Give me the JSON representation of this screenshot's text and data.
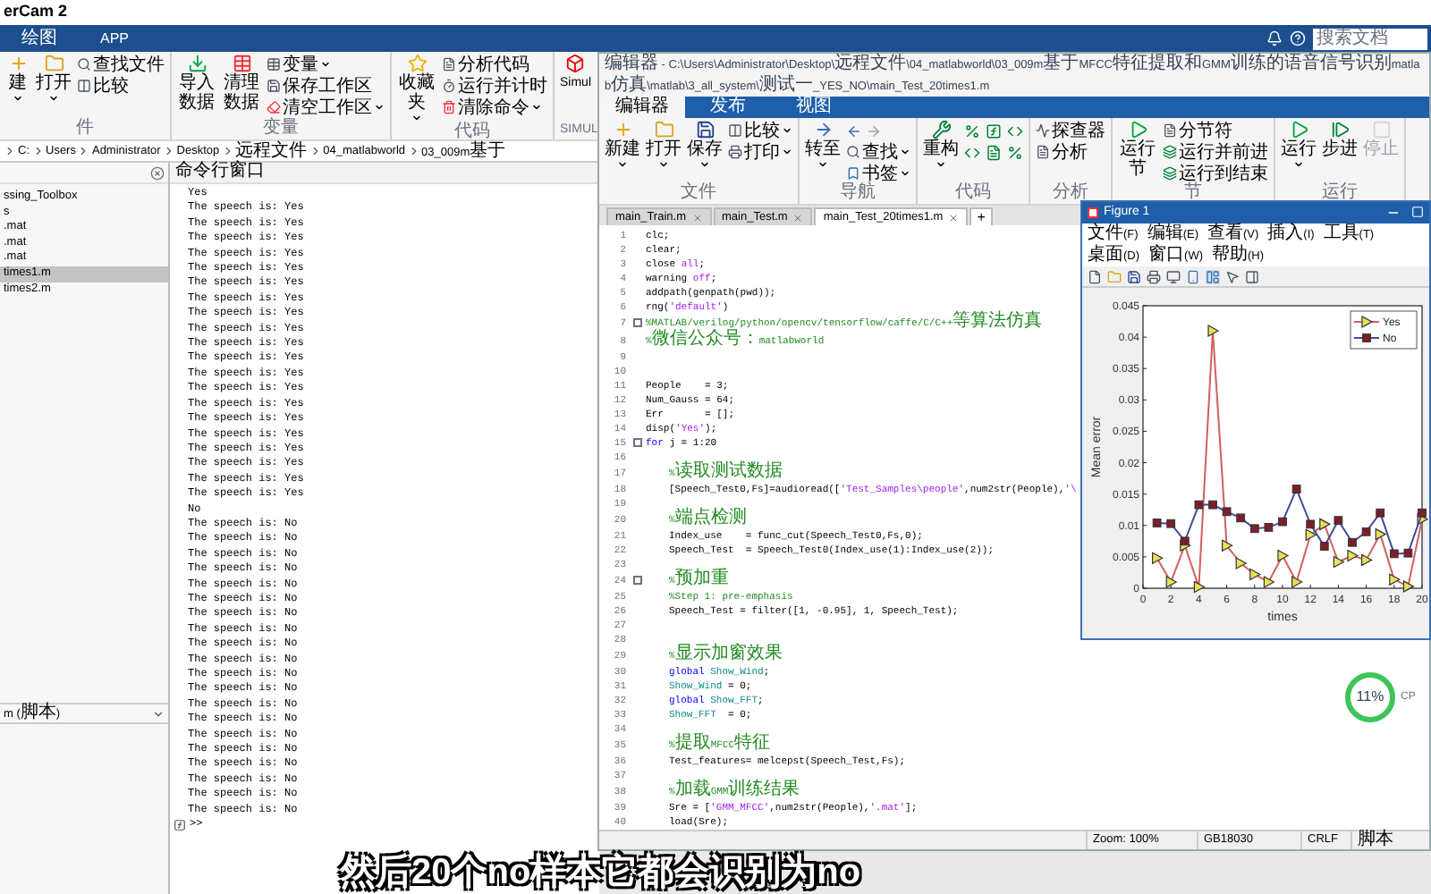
{
  "app_title": "erCam 2",
  "main_tabs": [
    {
      "label": "绘图",
      "selected": false
    },
    {
      "label": "APP",
      "selected": false
    }
  ],
  "search": {
    "placeholder": "搜索文档"
  },
  "main_toolstrip": [
    {
      "label": "件",
      "items": [
        {
          "label": "建",
          "kind": "large",
          "menu": true,
          "disabled": false
        },
        {
          "label": "打开",
          "kind": "large",
          "menu": true,
          "disabled": false
        },
        {
          "label": "查找文件",
          "kind": "small",
          "menu": false,
          "disabled": false
        },
        {
          "label": "比较",
          "kind": "small",
          "menu": false,
          "disabled": false
        }
      ]
    },
    {
      "label": "变量",
      "items": [
        {
          "label": "导入数据",
          "kind": "large",
          "menu": false,
          "disabled": false
        },
        {
          "label": "清理数据",
          "kind": "large",
          "menu": false,
          "disabled": false
        },
        {
          "label": "变量",
          "kind": "small",
          "menu": true,
          "disabled": false
        },
        {
          "label": "保存工作区",
          "kind": "small",
          "menu": false,
          "disabled": false
        },
        {
          "label": "清空工作区",
          "kind": "small",
          "menu": true,
          "disabled": false
        }
      ]
    },
    {
      "label": "代码",
      "items": [
        {
          "label": "收藏夹",
          "kind": "large",
          "menu": true,
          "disabled": false
        },
        {
          "label": "分析代码",
          "kind": "small",
          "menu": false,
          "disabled": false
        },
        {
          "label": "运行并计时",
          "kind": "small",
          "menu": false,
          "disabled": false
        },
        {
          "label": "清除命令",
          "kind": "small",
          "menu": true,
          "disabled": false
        }
      ]
    },
    {
      "label": "SIMUL",
      "items": [
        {
          "label": "Simul",
          "kind": "large",
          "menu": false,
          "disabled": false
        }
      ]
    }
  ],
  "path": [
    "C:",
    "Users",
    "Administrator",
    "Desktop",
    "远程文件",
    "04_matlabworld",
    "03_009m基于"
  ],
  "files": [
    {
      "name": "ssing_Toolbox",
      "selected": false
    },
    {
      "name": "s",
      "selected": false
    },
    {
      "name": ".mat",
      "selected": false
    },
    {
      "name": ".mat",
      "selected": false
    },
    {
      "name": ".mat",
      "selected": false
    },
    {
      "name": "times1.m",
      "selected": true
    },
    {
      "name": "times2.m",
      "selected": false
    }
  ],
  "file_details": "m (脚本)",
  "command_window": {
    "title": "命令行窗口",
    "lines": [
      "Yes",
      "The speech is: Yes",
      "The speech is: Yes",
      "The speech is: Yes",
      "The speech is: Yes",
      "The speech is: Yes",
      "The speech is: Yes",
      "The speech is: Yes",
      "The speech is: Yes",
      "The speech is: Yes",
      "The speech is: Yes",
      "The speech is: Yes",
      "The speech is: Yes",
      "The speech is: Yes",
      "The speech is: Yes",
      "The speech is: Yes",
      "The speech is: Yes",
      "The speech is: Yes",
      "The speech is: Yes",
      "The speech is: Yes",
      "The speech is: Yes",
      "No",
      "The speech is: No",
      "The speech is: No",
      "The speech is: No",
      "The speech is: No",
      "The speech is: No",
      "The speech is: No",
      "The speech is: No",
      "The speech is: No",
      "The speech is: No",
      "The speech is: No",
      "The speech is: No",
      "The speech is: No",
      "The speech is: No",
      "The speech is: No",
      "The speech is: No",
      "The speech is: No",
      "The speech is: No",
      "The speech is: No",
      "The speech is: No",
      "The speech is: No"
    ],
    "prompt": ">>"
  },
  "editor": {
    "title": "编辑器 - C:\\Users\\Administrator\\Desktop\\远程文件\\04_matlabworld\\03_009m基于MFCC特征提取和GMM训练的语音信号识别matlab仿真\\matlab\\3_all_system\\测试一_YES_NO\\main_Test_20times1.m",
    "tabs": [
      {
        "label": "编辑器",
        "selected": true
      },
      {
        "label": "发布",
        "selected": false
      },
      {
        "label": "视图",
        "selected": false
      }
    ],
    "toolstrip": [
      {
        "label": "文件",
        "items": [
          {
            "label": "新建",
            "kind": "large",
            "menu": true,
            "disabled": false
          },
          {
            "label": "打开",
            "kind": "large",
            "menu": true,
            "disabled": false
          },
          {
            "label": "保存",
            "kind": "large",
            "menu": true,
            "disabled": false
          },
          {
            "label": "比较",
            "kind": "small",
            "menu": true,
            "disabled": false
          },
          {
            "label": "打印",
            "kind": "small",
            "menu": true,
            "disabled": false
          }
        ]
      },
      {
        "label": "导航",
        "items": [
          {
            "label": "转至",
            "kind": "large",
            "menu": true,
            "disabled": false
          },
          {
            "kind": "arrows"
          },
          {
            "label": "查找",
            "kind": "small",
            "menu": true,
            "disabled": false
          },
          {
            "label": "书签",
            "kind": "small",
            "menu": true,
            "disabled": false
          }
        ]
      },
      {
        "label": "代码",
        "items": [
          {
            "label": "重构",
            "kind": "large",
            "menu": true,
            "disabled": false
          },
          {
            "kind": "grid"
          }
        ]
      },
      {
        "label": "分析",
        "items": [
          {
            "label": "探查器",
            "kind": "small",
            "menu": false,
            "disabled": false
          },
          {
            "label": "分析",
            "kind": "small",
            "menu": false,
            "disabled": false
          }
        ]
      },
      {
        "label": "节",
        "items": [
          {
            "label": "运行节",
            "kind": "large",
            "menu": false,
            "disabled": false
          },
          {
            "label": "分节符",
            "kind": "small",
            "menu": false,
            "disabled": false
          },
          {
            "label": "运行并前进",
            "kind": "small",
            "menu": false,
            "disabled": false
          },
          {
            "label": "运行到结束",
            "kind": "small",
            "menu": false,
            "disabled": false
          }
        ]
      },
      {
        "label": "运行",
        "items": [
          {
            "label": "运行",
            "kind": "large",
            "menu": true,
            "disabled": false
          },
          {
            "label": "步进",
            "kind": "large",
            "menu": false,
            "disabled": false
          },
          {
            "label": "停止",
            "kind": "large",
            "menu": false,
            "disabled": true
          }
        ]
      }
    ],
    "file_tabs": [
      {
        "label": "main_Train.m",
        "selected": false
      },
      {
        "label": "main_Test.m",
        "selected": false
      },
      {
        "label": "main_Test_20times1.m",
        "selected": true
      }
    ],
    "new_tab": "+",
    "code": [
      {
        "n": "1",
        "fold": false,
        "parts": [
          {
            "kind": "code",
            "text": "clc;"
          }
        ]
      },
      {
        "n": "2",
        "fold": false,
        "parts": [
          {
            "kind": "code",
            "text": "clear;"
          }
        ]
      },
      {
        "n": "3",
        "fold": false,
        "parts": [
          {
            "kind": "code",
            "text": "close "
          },
          {
            "kind": "string",
            "text": "all"
          },
          {
            "kind": "code",
            "text": ";"
          }
        ]
      },
      {
        "n": "4",
        "fold": false,
        "parts": [
          {
            "kind": "code",
            "text": "warning "
          },
          {
            "kind": "string",
            "text": "off"
          },
          {
            "kind": "code",
            "text": ";"
          }
        ]
      },
      {
        "n": "5",
        "fold": false,
        "parts": [
          {
            "kind": "code",
            "text": "addpath(genpath(pwd));"
          }
        ]
      },
      {
        "n": "6",
        "fold": false,
        "parts": [
          {
            "kind": "code",
            "text": "rng("
          },
          {
            "kind": "string",
            "text": "'default'"
          },
          {
            "kind": "code",
            "text": ")"
          }
        ]
      },
      {
        "n": "7",
        "fold": true,
        "parts": [
          {
            "kind": "comment",
            "text": "%MATLAB/verilog/python/opencv/tensorflow/caffe/C/C++等算法仿真"
          }
        ]
      },
      {
        "n": "8",
        "fold": false,
        "parts": [
          {
            "kind": "comment",
            "text": "%微信公众号：matlabworld"
          }
        ]
      },
      {
        "n": "9",
        "fold": false
      },
      {
        "n": "10",
        "fold": false
      },
      {
        "n": "11",
        "fold": false,
        "parts": [
          {
            "kind": "code",
            "text": "People    = 3;"
          }
        ]
      },
      {
        "n": "12",
        "fold": false,
        "parts": [
          {
            "kind": "code",
            "text": "Num_Gauss = 64;"
          }
        ]
      },
      {
        "n": "13",
        "fold": false,
        "parts": [
          {
            "kind": "code",
            "text": "Err       = [];"
          }
        ]
      },
      {
        "n": "14",
        "fold": false,
        "parts": [
          {
            "kind": "code",
            "text": "disp("
          },
          {
            "kind": "string",
            "text": "'Yes'"
          },
          {
            "kind": "code",
            "text": ");"
          }
        ]
      },
      {
        "n": "15",
        "fold": true,
        "parts": [
          {
            "kind": "keyword",
            "text": "for"
          },
          {
            "kind": "code",
            "text": " j = 1:20"
          }
        ],
        "children": [
          {
            "n": "16",
            "fold": false
          },
          {
            "n": "17",
            "fold": false,
            "parts": [
              {
                "kind": "comment",
                "text": "%读取测试数据"
              }
            ]
          },
          {
            "n": "18",
            "fold": false,
            "parts": [
              {
                "kind": "code",
                "text": "[Speech_Test0,Fs]=audioread(["
              },
              {
                "kind": "string",
                "text": "'Test_Samples\\people'"
              },
              {
                "kind": "code",
                "text": ",num2str(People),"
              },
              {
                "kind": "string",
                "text": "'\\"
              }
            ]
          },
          {
            "n": "19",
            "fold": false
          },
          {
            "n": "20",
            "fold": false,
            "parts": [
              {
                "kind": "comment",
                "text": "%端点检测"
              }
            ]
          },
          {
            "n": "21",
            "fold": false,
            "parts": [
              {
                "kind": "code",
                "text": "Index_use    = func_cut(Speech_Test0,Fs,0);"
              }
            ]
          },
          {
            "n": "22",
            "fold": false,
            "parts": [
              {
                "kind": "code",
                "text": "Speech_Test  = Speech_Test0(Index_use(1):Index_use(2));"
              }
            ]
          },
          {
            "n": "23",
            "fold": false
          },
          {
            "n": "24",
            "fold": true,
            "parts": [
              {
                "kind": "comment",
                "text": "%预加重"
              }
            ]
          },
          {
            "n": "25",
            "fold": false,
            "parts": [
              {
                "kind": "comment",
                "text": "%Step 1: pre-emphasis"
              }
            ]
          },
          {
            "n": "26",
            "fold": false,
            "parts": [
              {
                "kind": "code",
                "text": "Speech_Test = filter([1, -0.95], 1, Speech_Test);"
              }
            ]
          },
          {
            "n": "27",
            "fold": false
          },
          {
            "n": "28",
            "fold": false
          },
          {
            "n": "29",
            "fold": false,
            "parts": [
              {
                "kind": "comment",
                "text": "%显示加窗效果"
              }
            ]
          },
          {
            "n": "30",
            "fold": false,
            "parts": [
              {
                "kind": "keyword",
                "text": "global "
              },
              {
                "kind": "global",
                "text": "Show_Wind"
              },
              {
                "kind": "code",
                "text": ";"
              }
            ]
          },
          {
            "n": "31",
            "fold": false,
            "parts": [
              {
                "kind": "global",
                "text": "Show_Wind"
              },
              {
                "kind": "code",
                "text": " = 0;"
              }
            ]
          },
          {
            "n": "32",
            "fold": false,
            "parts": [
              {
                "kind": "keyword",
                "text": "global "
              },
              {
                "kind": "global",
                "text": "Show_FFT"
              },
              {
                "kind": "code",
                "text": ";"
              }
            ]
          },
          {
            "n": "33",
            "fold": false,
            "parts": [
              {
                "kind": "global",
                "text": "Show_FFT"
              },
              {
                "kind": "code",
                "text": "  = 0;"
              }
            ]
          },
          {
            "n": "34",
            "fold": false
          },
          {
            "n": "35",
            "fold": false,
            "parts": [
              {
                "kind": "comment",
                "text": "%提取MFCC特征"
              }
            ]
          },
          {
            "n": "36",
            "fold": false,
            "parts": [
              {
                "kind": "code",
                "text": "Test_features= melcepst(Speech_Test,Fs);"
              }
            ]
          },
          {
            "n": "37",
            "fold": false
          },
          {
            "n": "38",
            "fold": false,
            "parts": [
              {
                "kind": "comment",
                "text": "%加载GMM训练结果"
              }
            ]
          },
          {
            "n": "39",
            "fold": false,
            "parts": [
              {
                "kind": "code",
                "text": "Sre = ["
              },
              {
                "kind": "string",
                "text": "'GMM_MFCC'"
              },
              {
                "kind": "code",
                "text": ",num2str(People),"
              },
              {
                "kind": "string",
                "text": "'.mat'"
              },
              {
                "kind": "code",
                "text": "];"
              }
            ]
          },
          {
            "n": "40",
            "fold": false,
            "parts": [
              {
                "kind": "code",
                "text": "load(Sre);"
              }
            ]
          }
        ]
      }
    ],
    "status_bar": [
      "Zoom: 100%",
      "GB18030",
      "CRLF",
      "脚本"
    ]
  },
  "figure": {
    "title": "Figure 1",
    "menu": [
      "文件(F)",
      "编辑(E)",
      "查看(V)",
      "插入(I)",
      "工具(T)",
      "桌面(D)",
      "窗口(W)",
      "帮助(H)"
    ],
    "chart_data": {
      "type": "line",
      "xlabel": "times",
      "ylabel": "Mean error",
      "x": [
        1,
        2,
        3,
        4,
        5,
        6,
        7,
        8,
        9,
        10,
        11,
        12,
        13,
        14,
        15,
        16,
        17,
        18,
        19,
        20
      ],
      "series": [
        {
          "name": "Yes",
          "color": "#d0605e",
          "marker": "triangle",
          "values": [
            0.0048,
            0.001,
            0.0068,
            0.0002,
            0.041,
            0.0068,
            0.004,
            0.0022,
            0.001,
            0.0052,
            0.001,
            0.0085,
            0.0102,
            0.0042,
            0.0052,
            0.0045,
            0.0086,
            0.0014,
            0.0003,
            0.011
          ]
        },
        {
          "name": "No",
          "color": "#3e4c9e",
          "marker": "square",
          "values": [
            0.0104,
            0.0103,
            0.0075,
            0.0133,
            0.0133,
            0.0122,
            0.0112,
            0.0095,
            0.0097,
            0.0106,
            0.0158,
            0.0102,
            0.0067,
            0.0108,
            0.0073,
            0.009,
            0.012,
            0.0055,
            0.0056,
            0.012
          ]
        }
      ],
      "legend": true,
      "xlim": [
        0,
        20
      ],
      "ylim": [
        0,
        0.045
      ],
      "xticks": [
        {
          "value": 0,
          "label": "0"
        },
        {
          "value": 2,
          "label": "2"
        },
        {
          "value": 4,
          "label": "4"
        },
        {
          "value": 6,
          "label": "6"
        },
        {
          "value": 8,
          "label": "8"
        },
        {
          "value": 10,
          "label": "10"
        },
        {
          "value": 12,
          "label": "12"
        },
        {
          "value": 14,
          "label": "14"
        },
        {
          "value": 16,
          "label": "16"
        },
        {
          "value": 18,
          "label": "18"
        },
        {
          "value": 20,
          "label": "20"
        }
      ],
      "yticks": [
        0,
        0.005,
        0.01,
        0.015,
        0.02,
        0.025,
        0.03,
        0.035,
        0.04,
        0.045
      ]
    }
  },
  "cpu_meter": {
    "reading": "11%",
    "label": "CP"
  },
  "caption": "然后20个no样本它都会识别为no"
}
